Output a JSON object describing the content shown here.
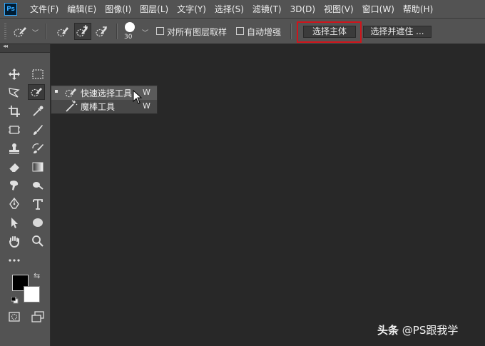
{
  "app": {
    "logo_text": "Ps"
  },
  "menu": [
    "文件(F)",
    "编辑(E)",
    "图像(I)",
    "图层(L)",
    "文字(Y)",
    "选择(S)",
    "滤镜(T)",
    "3D(D)",
    "视图(V)",
    "窗口(W)",
    "帮助(H)"
  ],
  "options": {
    "brush_size": "30",
    "sample_all_layers_label": "对所有图层取样",
    "sample_all_layers_checked": false,
    "auto_enhance_label": "自动增强",
    "auto_enhance_checked": false,
    "select_subject_label": "选择主体",
    "select_and_mask_label": "选择并遮住 ..."
  },
  "flyout": {
    "items": [
      {
        "label": "快速选择工具",
        "shortcut": "W",
        "selected": true,
        "icon": "quick-selection-icon"
      },
      {
        "label": "魔棒工具",
        "shortcut": "W",
        "selected": false,
        "icon": "magic-wand-icon"
      }
    ]
  },
  "colors": {
    "foreground": "#000000",
    "background": "#ffffff",
    "highlight_box": "#d0141b",
    "panel": "#535353",
    "canvas": "#282828"
  },
  "watermark": {
    "brand": "头条",
    "handle": "@PS跟我学"
  }
}
